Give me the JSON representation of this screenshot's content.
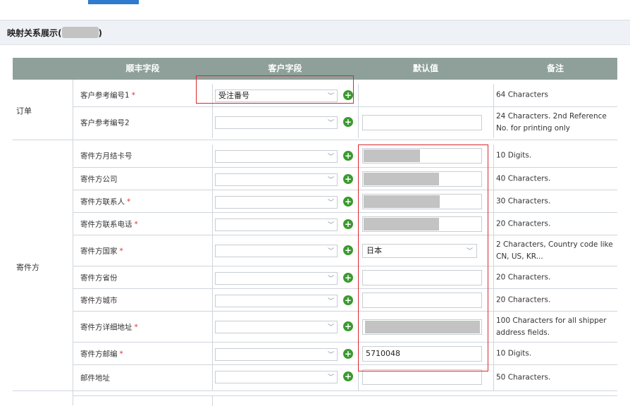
{
  "section_title": "映射关系展示(",
  "section_title_close": ")",
  "columns": [
    "顺丰字段",
    "客户字段",
    "默认值",
    "备注"
  ],
  "groups": [
    {
      "label": "订单",
      "rows": [
        {
          "field": "客户参考编号1",
          "required": true,
          "selected": "受注番号",
          "default": "",
          "note": "64 Characters"
        },
        {
          "field": "客户参考编号2",
          "required": false,
          "selected": "",
          "default": "",
          "note": "24 Characters. 2nd Reference No. for printing only"
        }
      ]
    },
    {
      "label": "寄件方",
      "rows": [
        {
          "field": "寄件方月结卡号",
          "required": false,
          "selected": "",
          "default": "",
          "redacted": true,
          "note": "10 Digits."
        },
        {
          "field": "寄件方公司",
          "required": false,
          "selected": "",
          "default": "",
          "redacted": true,
          "note": "40 Characters."
        },
        {
          "field": "寄件方联系人",
          "required": true,
          "selected": "",
          "default": "",
          "redacted": true,
          "note": "30 Characters."
        },
        {
          "field": "寄件方联系电话",
          "required": true,
          "selected": "",
          "default": "",
          "redacted": true,
          "note": "20 Characters."
        },
        {
          "field": "寄件方国家",
          "required": true,
          "selected": "",
          "default": "日本",
          "note": "2 Characters, Country code like CN, US, KR..."
        },
        {
          "field": "寄件方省份",
          "required": false,
          "selected": "",
          "default": "",
          "note": "20 Characters."
        },
        {
          "field": "寄件方城市",
          "required": false,
          "selected": "",
          "default": "",
          "note": "20 Characters."
        },
        {
          "field": "寄件方详细地址",
          "required": true,
          "selected": "",
          "default": "",
          "redacted": true,
          "note": "100 Characters for all shipper address fields."
        },
        {
          "field": "寄件方邮编",
          "required": true,
          "selected": "",
          "default": "5710048",
          "note": "10 Digits."
        },
        {
          "field": "邮件地址",
          "required": false,
          "selected": "",
          "default": "",
          "note": "50 Characters."
        }
      ]
    }
  ],
  "icons": {
    "add": "plus-circle-icon",
    "dropdown": "chevron-down-icon"
  },
  "colors": {
    "header_bg": "#8fa09a",
    "highlight": "#d9282f",
    "add_green": "#3a9a2e"
  }
}
